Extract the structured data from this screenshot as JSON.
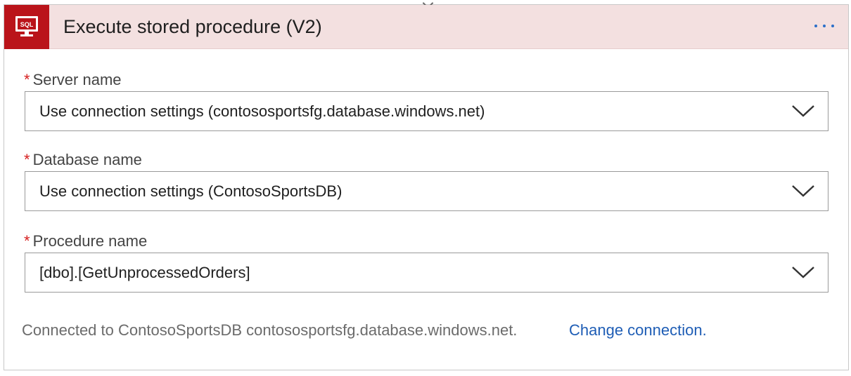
{
  "header": {
    "icon": "sql-server-icon",
    "icon_text": "SQL",
    "title": "Execute stored procedure (V2)",
    "more_icon": "ellipsis-icon",
    "brand_color": "#ba141a",
    "header_bg": "#f3e0e0"
  },
  "fields": [
    {
      "required_mark": "*",
      "label": "Server name",
      "value": "Use connection settings (contososportsfg.database.windows.net)",
      "icon": "chevron-down-icon"
    },
    {
      "required_mark": "*",
      "label": "Database name",
      "value": "Use connection settings (ContosoSportsDB)",
      "icon": "chevron-down-icon"
    },
    {
      "required_mark": "*",
      "label": "Procedure name",
      "value": "[dbo].[GetUnprocessedOrders]",
      "icon": "chevron-down-icon"
    }
  ],
  "footer": {
    "connection_text": "Connected to ContosoSportsDB contososportsfg.database.windows.net.",
    "change_link": "Change connection.",
    "link_color": "#1e5db5"
  }
}
